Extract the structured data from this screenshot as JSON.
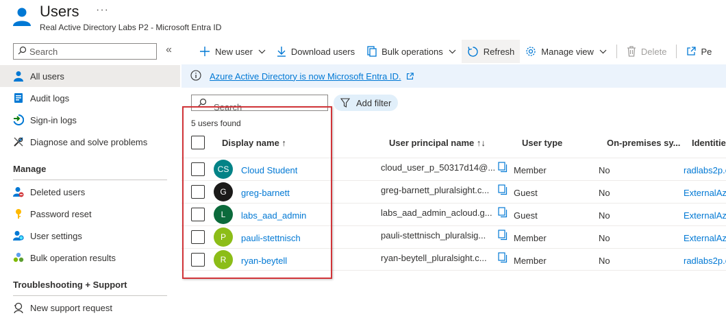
{
  "header": {
    "title": "Users",
    "more": "···",
    "subtitle": "Real Active Directory Labs P2 - Microsoft Entra ID"
  },
  "sidebar": {
    "search_placeholder": "Search",
    "collapse": "«",
    "items": [
      {
        "label": "All users",
        "icon": "user-icon"
      },
      {
        "label": "Audit logs",
        "icon": "audit-log-icon"
      },
      {
        "label": "Sign-in logs",
        "icon": "sign-in-icon"
      },
      {
        "label": "Diagnose and solve problems",
        "icon": "wrench-icon"
      }
    ],
    "manage_heading": "Manage",
    "manage_items": [
      {
        "label": "Deleted users",
        "icon": "deleted-user-icon"
      },
      {
        "label": "Password reset",
        "icon": "key-icon"
      },
      {
        "label": "User settings",
        "icon": "user-settings-icon"
      },
      {
        "label": "Bulk operation results",
        "icon": "bulk-results-icon"
      }
    ],
    "support_heading": "Troubleshooting + Support",
    "support_items": [
      {
        "label": "New support request",
        "icon": "support-icon"
      }
    ]
  },
  "toolbar": {
    "new_user": "New user",
    "download_users": "Download users",
    "bulk_operations": "Bulk operations",
    "refresh": "Refresh",
    "manage_view": "Manage view",
    "delete": "Delete",
    "permissions_partial": "Pe"
  },
  "banner": {
    "text": "Azure Active Directory is now Microsoft Entra ID."
  },
  "filter": {
    "search_placeholder": "Search",
    "add_filter": "Add filter"
  },
  "results": {
    "count_text": "5 users found"
  },
  "table": {
    "headers": {
      "display_name": "Display name ↑",
      "upn": "User principal name ↑↓",
      "user_type": "User type",
      "on_prem": "On-premises sy...",
      "identities": "Identitie"
    },
    "rows": [
      {
        "initials": "CS",
        "avatar_color": "#038387",
        "name": "Cloud Student",
        "upn": "cloud_user_p_50317d14@...",
        "type": "Member",
        "on_prem": "No",
        "identity": "radlabs2p.o"
      },
      {
        "initials": "G",
        "avatar_color": "#1b1a19",
        "name": "greg-barnett",
        "upn": "greg-barnett_pluralsight.c...",
        "type": "Guest",
        "on_prem": "No",
        "identity": "ExternalAzu"
      },
      {
        "initials": "L",
        "avatar_color": "#0b6a3b",
        "name": "labs_aad_admin",
        "upn": "labs_aad_admin_acloud.g...",
        "type": "Guest",
        "on_prem": "No",
        "identity": "ExternalAzu"
      },
      {
        "initials": "P",
        "avatar_color": "#8cbd18",
        "name": "pauli-stettnisch",
        "upn": "pauli-stettnisch_pluralsig...",
        "type": "Member",
        "on_prem": "No",
        "identity": "ExternalAzu"
      },
      {
        "initials": "R",
        "avatar_color": "#8cbd18",
        "name": "ryan-beytell",
        "upn": "ryan-beytell_pluralsight.c...",
        "type": "Member",
        "on_prem": "No",
        "identity": "radlabs2p.o"
      }
    ]
  },
  "colors": {
    "accent": "#0078d4",
    "highlight_border": "#d13438",
    "banner_bg": "#ebf3fc"
  }
}
